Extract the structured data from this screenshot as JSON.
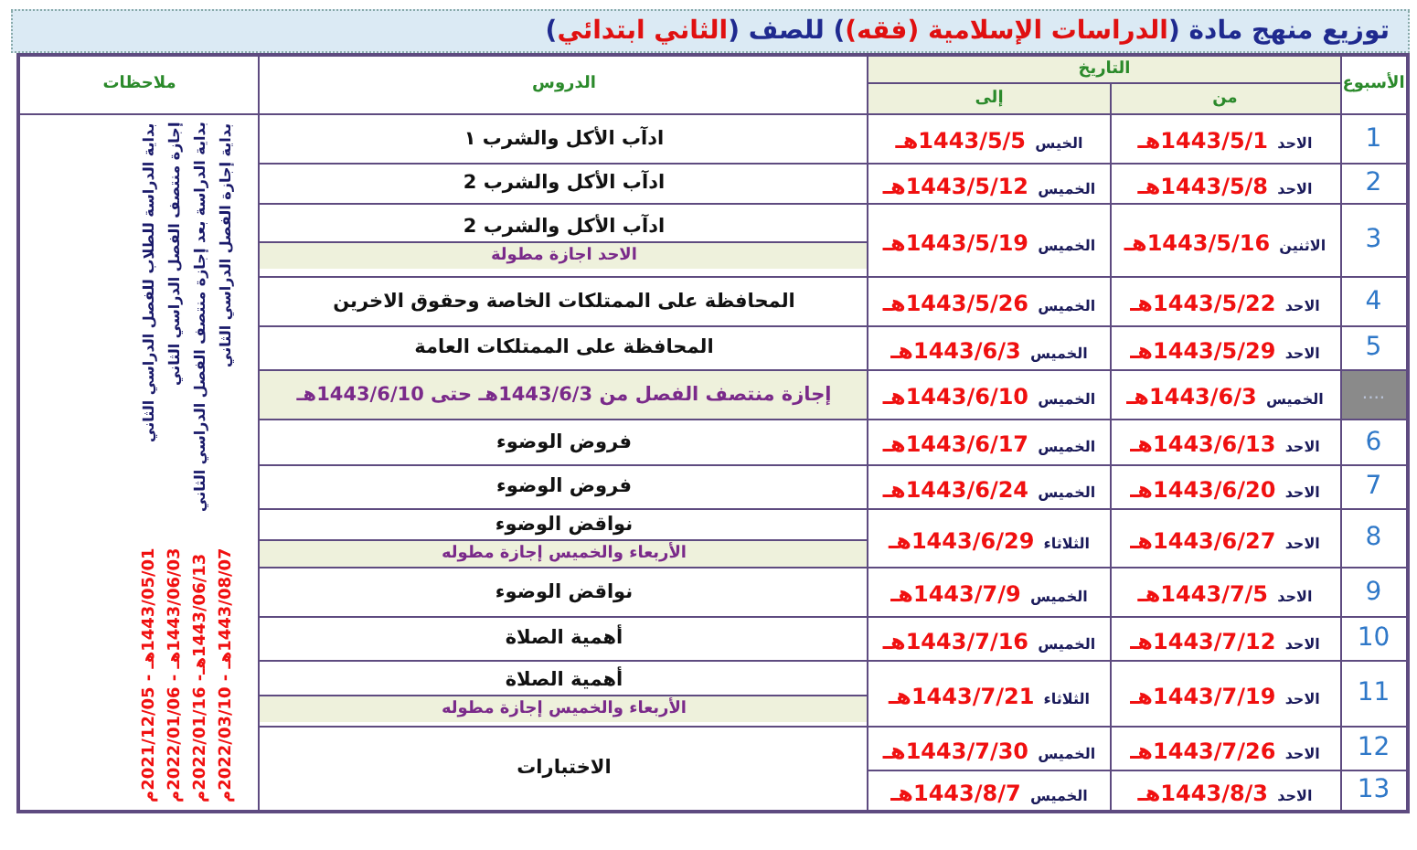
{
  "title": [
    {
      "text": "توزيع منهج مادة (",
      "highlight": false
    },
    {
      "text": "الدراسات الإسلامية (فقه)",
      "highlight": true
    },
    {
      "text": ") للصف (",
      "highlight": false
    },
    {
      "text": "الثاني ابتدائي",
      "highlight": true
    },
    {
      "text": ")",
      "highlight": false
    }
  ],
  "table": {
    "columns": {
      "week": "الأسبوع",
      "date": "التاريخ",
      "from": "من",
      "to": "إلى",
      "lessons": "الدروس",
      "notes": "ملاحظات"
    },
    "rows": [
      {
        "kind": "week",
        "week": "1",
        "from_day": "الاحد",
        "from_date": "1443/5/1هـ",
        "to_day": "الخيس",
        "to_date": "1443/5/5هـ",
        "lesson": "ادآب الأكل والشرب ١"
      },
      {
        "kind": "week",
        "week": "2",
        "from_day": "الاحد",
        "from_date": "1443/5/8هـ",
        "to_day": "الخميس",
        "to_date": "1443/5/12هـ",
        "lesson": "ادآب الأكل والشرب 2"
      },
      {
        "kind": "week",
        "week": "3",
        "from_day": "الاثنين",
        "from_date": "1443/5/16هـ",
        "to_day": "الخميس",
        "to_date": "1443/5/19هـ",
        "lesson": "ادآب الأكل والشرب 2",
        "note": "الاحد اجازة مطولة"
      },
      {
        "kind": "week",
        "week": "4",
        "from_day": "الاحد",
        "from_date": "1443/5/22هـ",
        "to_day": "الخميس",
        "to_date": "1443/5/26هـ",
        "lesson": "المحافظة على الممتلكات الخاصة وحقوق الاخرين"
      },
      {
        "kind": "week",
        "week": "5",
        "from_day": "الاحد",
        "from_date": "1443/5/29هـ",
        "to_day": "الخميس",
        "to_date": "1443/6/3هـ",
        "lesson": "المحافظة على الممتلكات العامة"
      },
      {
        "kind": "break",
        "week": "....",
        "from_day": "الخميس",
        "from_date": "1443/6/3هـ",
        "to_day": "الخميس",
        "to_date": "1443/6/10هـ",
        "lesson": "إجازة منتصف الفصل  من **1443/6/3هـ** حتى **1443/6/10هـ**"
      },
      {
        "kind": "week",
        "week": "6",
        "from_day": "الاحد",
        "from_date": "1443/6/13هـ",
        "to_day": "الخميس",
        "to_date": "1443/6/17هـ",
        "lesson": "فروض الوضوء"
      },
      {
        "kind": "week",
        "week": "7",
        "from_day": "الاحد",
        "from_date": "1443/6/20هـ",
        "to_day": "الخميس",
        "to_date": "1443/6/24هـ",
        "lesson": "فروض الوضوء"
      },
      {
        "kind": "week",
        "week": "8",
        "from_day": "الاحد",
        "from_date": "1443/6/27هـ",
        "to_day": "الثلاثاء",
        "to_date": "1443/6/29هـ",
        "lesson": "نواقض الوضوء",
        "note": "الأربعاء والخميس إجازة مطوله"
      },
      {
        "kind": "week",
        "week": "9",
        "from_day": "الاحد",
        "from_date": "1443/7/5هـ",
        "to_day": "الخميس",
        "to_date": "1443/7/9هـ",
        "lesson": "نواقض الوضوء"
      },
      {
        "kind": "week",
        "week": "10",
        "from_day": "الاحد",
        "from_date": "1443/7/12هـ",
        "to_day": "الخميس",
        "to_date": "1443/7/16هـ",
        "lesson": "أهمية الصلاة"
      },
      {
        "kind": "week",
        "week": "11",
        "from_day": "الاحد",
        "from_date": "1443/7/19هـ",
        "to_day": "الثلاثاء",
        "to_date": "1443/7/21هـ",
        "lesson": "أهمية الصلاة",
        "note": "الأربعاء والخميس إجازة مطوله"
      },
      {
        "kind": "week",
        "week": "12",
        "from_day": "الاحد",
        "from_date": "1443/7/26هـ",
        "to_day": "الخميس",
        "to_date": "1443/7/30هـ",
        "lesson": "الاختبارات"
      },
      {
        "kind": "week",
        "week": "13",
        "from_day": "الاحد",
        "from_date": "1443/8/3هـ",
        "to_day": "الخميس",
        "to_date": "1443/8/7هـ"
      }
    ],
    "notes": [
      {
        "text": "بداية الدراسة للطلاب للفصل الدراسي الثاني",
        "dates": "1443/05/01هـ - 2021/12/05م"
      },
      {
        "text": "إجازة منتصف الفصل الدراسي الثاني",
        "dates": "1443/06/03هـ - 2022/01/06م"
      },
      {
        "text": "بداية الدراسة بعد إجازة منتصف الفصل الدراسي الثاني",
        "dates": "1443/06/13هـ- 2022/01/16م"
      },
      {
        "text": "بداية إجازة الفصل الدراسي الثاني",
        "dates": "1443/08/07هـ - 2022/03/10م"
      }
    ]
  }
}
